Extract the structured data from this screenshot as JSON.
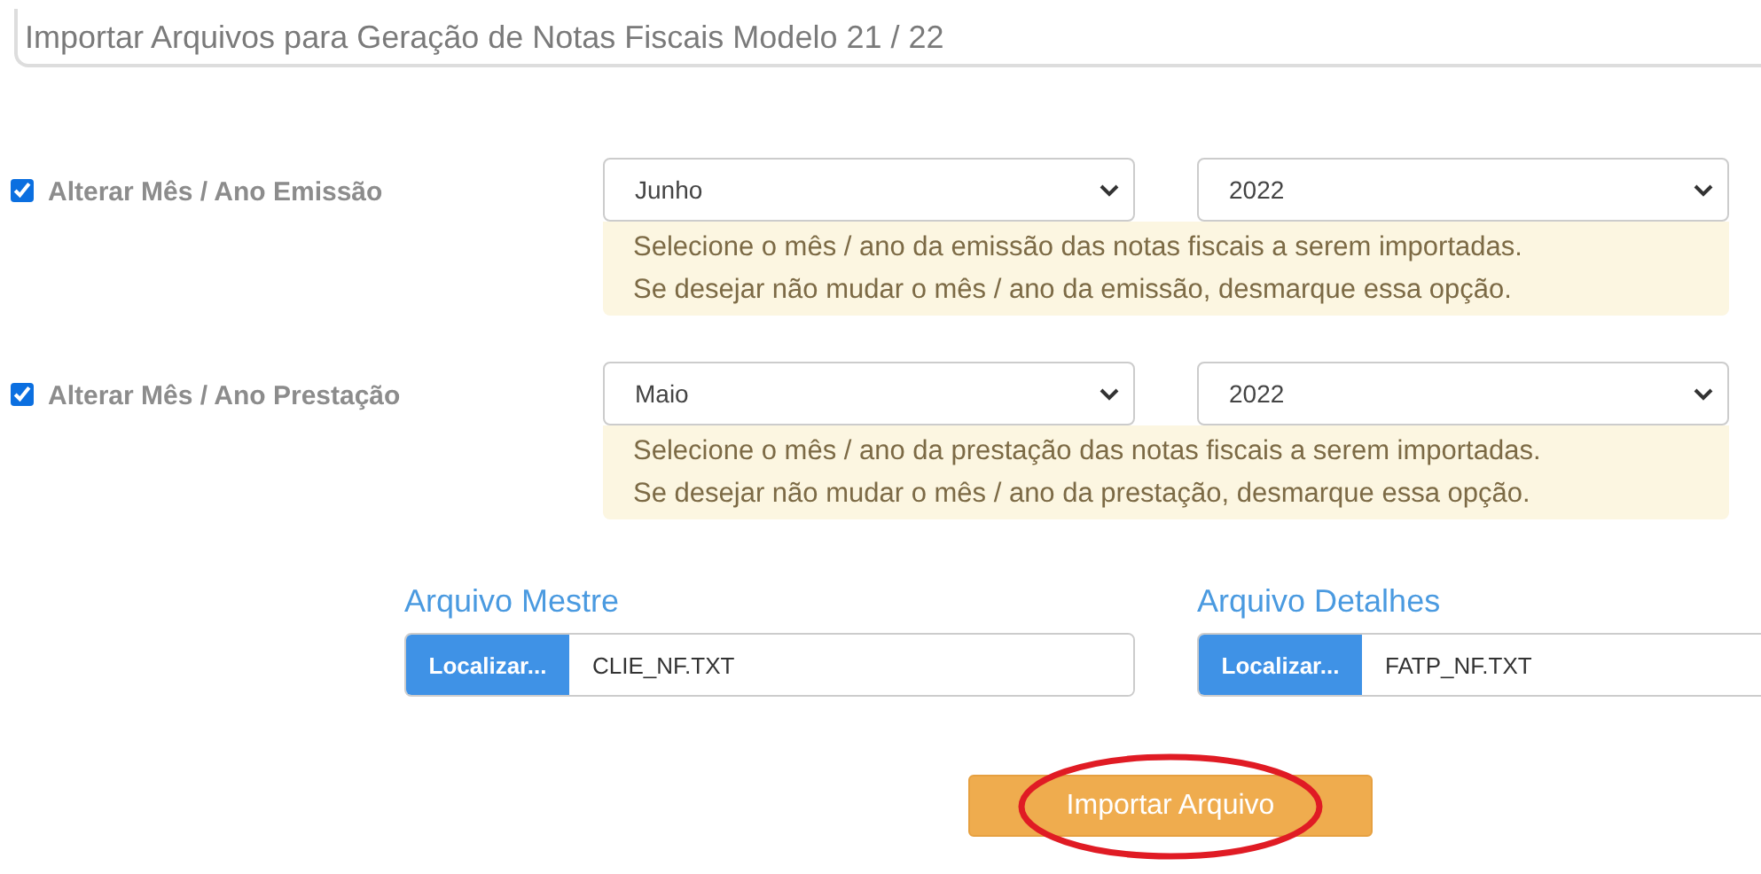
{
  "header": {
    "title": "Importar Arquivos para Geração de Notas Fiscais Modelo 21 / 22"
  },
  "options": [
    {
      "label": "Alterar Mês / Ano Emissão",
      "checked": true,
      "month": "Junho",
      "year": "2022",
      "hints": [
        "Selecione o mês / ano da emissão das notas fiscais a serem importadas.",
        "Se desejar não mudar o mês / ano da emissão, desmarque essa opção."
      ]
    },
    {
      "label": "Alterar Mês / Ano Prestação",
      "checked": true,
      "month": "Maio",
      "year": "2022",
      "hints": [
        "Selecione o mês / ano da prestação das notas fiscais a serem importadas.",
        "Se desejar não mudar o mês / ano da prestação, desmarque essa opção."
      ]
    }
  ],
  "files": [
    {
      "label": "Arquivo Mestre",
      "button": "Localizar...",
      "value": "CLIE_NF.TXT"
    },
    {
      "label": "Arquivo Detalhes",
      "button": "Localizar...",
      "value": "FATP_NF.TXT"
    }
  ],
  "submit": {
    "label": "Importar Arquivo",
    "highlighted": true
  }
}
